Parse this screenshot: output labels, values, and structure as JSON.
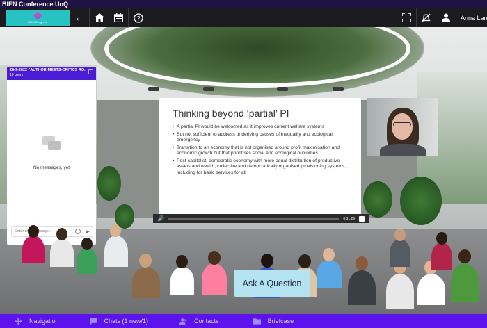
{
  "window": {
    "title": "BIEN Conference UoQ"
  },
  "toolbar": {
    "logo_text": "BIEN Congress",
    "back_label": "Back",
    "home_label": "Home",
    "agenda_label": "Agenda",
    "help_label": "Help",
    "fullscreen_label": "Fullscreen",
    "mute_label": "Notifications off",
    "user_name": "Anna Lam"
  },
  "chat": {
    "title": "28-9-2022 \"AUTHOR-MEETS-CRITICS RO...",
    "users": "10 users",
    "empty_text": "No messages, yet",
    "input_placeholder": "Enter chat message..."
  },
  "slide": {
    "title": "Thinking beyond ‘partial’ PI",
    "bullets": [
      "A partial PI would be welcomed as it improves current welfare systems",
      "But not sufficient to address underlying causes of inequality and ecological emergency",
      "Transition to an economy that is not organised around profit maximisation and economic growth but that prioritises social and ecological outcomes",
      "Post-capitalist, democratic economy with more equal distribution of productive assets and wealth; collective and democratically organised provisioning systems, including for basic services for all"
    ]
  },
  "player": {
    "time": "0:31:29"
  },
  "ask_button": {
    "label": "Ask A Question"
  },
  "bottom_nav": {
    "navigation": "Navigation",
    "chats": "Chats (1 new/1)",
    "contacts": "Contacts",
    "briefcase": "Briefcase"
  },
  "colors": {
    "toolbar_bg": "#1b1b1f",
    "bottombar_bg": "#5d13ec",
    "chat_header": "#4b1bd6",
    "ask_button_bg": "#b6e3f2",
    "logo_bg": "#27c3c2"
  }
}
